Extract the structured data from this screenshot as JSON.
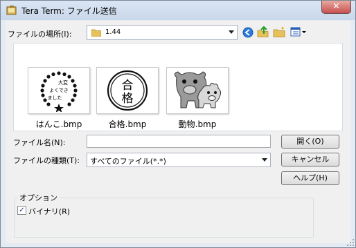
{
  "window": {
    "title": "Tera Term: ファイル送信",
    "close_glyph": "✕"
  },
  "location": {
    "label": "ファイルの場所(I):",
    "value": "1.44",
    "folder_icon": "folder-icon"
  },
  "toolbar": {
    "back_icon": "back-arrow-icon",
    "up_icon": "up-folder-icon",
    "new_folder_icon": "new-folder-icon",
    "view_menu_icon": "view-menu-icon"
  },
  "files": [
    {
      "name": "はんこ.bmp",
      "stamp_text": [
        "大変",
        "よくでき",
        "ました"
      ]
    },
    {
      "name": "合格.bmp",
      "stamp_text": [
        "合",
        "格"
      ]
    },
    {
      "name": "動物.bmp"
    }
  ],
  "filename": {
    "label": "ファイル名(N):",
    "value": ""
  },
  "filetype": {
    "label": "ファイルの種類(T):",
    "value": "すべてのファイル(*.*)"
  },
  "buttons": {
    "open": "開く(O)",
    "cancel": "キャンセル",
    "help": "ヘルプ(H)"
  },
  "options": {
    "title": "オプション",
    "binary_label": "バイナリ(R)",
    "binary_checked": true,
    "check_glyph": "✓"
  },
  "colors": {
    "titlebar": "#c8d7ea",
    "close_button": "#c75050",
    "dialog_bg": "#f0f0f0"
  }
}
